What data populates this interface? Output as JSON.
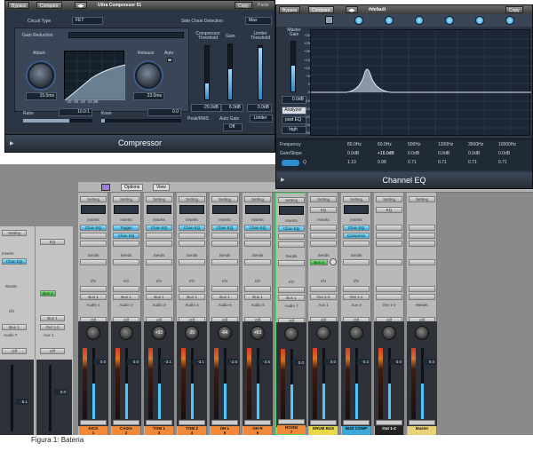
{
  "compressor": {
    "bypass": "Bypass",
    "compare": "Compare",
    "preset": "Ultra Compressor 01",
    "copy": "Copy",
    "paste": "Paste",
    "circuit_type_label": "Circuit Type",
    "circuit_type_value": "FET",
    "side_chain_label": "Side Chain Detection",
    "side_chain_value": "Max",
    "gain_reduction": "Gain Reduction",
    "attack_label": "Attack",
    "attack_value": "15.5ms",
    "release_label": "Release",
    "release_value": "23.0ms",
    "auto_label": "Auto",
    "graph_scale": "-40 -30 -20 -10 dB",
    "ratio_label": "Ratio",
    "ratio_value": "10.0:1",
    "knee_label": "Knee",
    "knee_value": "0.0",
    "threshold_label": "Compressor Threshold",
    "threshold_value": "-29.0dB",
    "gain_label": "Gain",
    "gain_value": "6.0dB",
    "limiter_label": "Limiter Threshold",
    "limiter_value": "0.0dB",
    "peak_rms": "Peak/RMS",
    "auto_gain_label": "Auto Gain",
    "auto_gain_value": "Off",
    "limiter_btn": "Limiter",
    "title": "Compressor"
  },
  "eq": {
    "bypass": "Bypass",
    "compare": "Compare",
    "preset": "#default",
    "copy": "Copy",
    "master_gain_label": "Master Gain",
    "master_value": "0.0dB",
    "analyzer": "Analyzer",
    "post_eq": "post EQ",
    "high": "high",
    "db_scale": [
      "+30",
      "+25",
      "+20",
      "+15",
      "+10",
      "+5",
      "0",
      "-5",
      "-10",
      "-15",
      "-20",
      "-25",
      "-30"
    ],
    "freq_scale": [
      "20",
      "50",
      "100",
      "200",
      "500",
      "1k",
      "2k",
      "5k",
      "10k",
      "20k"
    ],
    "frequency_label": "Frequency",
    "gain_slope_label": "Gain/Slope",
    "q_label": "Q",
    "freqs": [
      "80.0Hz",
      "60.0Hz",
      "500Hz",
      "1200Hz",
      "3500Hz",
      "10000Hz"
    ],
    "gains": [
      "0.0dB",
      "+16.0dB",
      "0.0dB",
      "0.0dB",
      "0.0dB",
      "0.0dB"
    ],
    "qs": [
      "1.10",
      "0.98",
      "0.71",
      "0.71",
      "0.71",
      "0.71"
    ],
    "title": "Channel EQ"
  },
  "mixer": {
    "options": "Options",
    "view": "View",
    "setting": "Setting",
    "inserts": "Inserts",
    "sends": "Sends",
    "io": "I/O",
    "off": "Off",
    "left_strips": [
      {
        "eq": "",
        "insert": "Chan EQ",
        "send": "",
        "out": "Bus 1",
        "route": "Audio 7",
        "gain": "-5.1"
      },
      {
        "eq": "EQ",
        "insert": "",
        "send": "Bus 2",
        "out": "Bus 1",
        "route": "Aux 1",
        "gain": "0.0",
        "out2": "Out 1-2"
      }
    ],
    "strips": [
      {
        "name": "KICK",
        "num": "1",
        "insert1": "Chan EQ",
        "insert2": "",
        "out": "Bus 1",
        "route": "Audio 1",
        "pan": "",
        "gain": "0.0",
        "color": "#f08a3a"
      },
      {
        "name": "CAIXA",
        "num": "2",
        "insert1": "Trigger",
        "insert2": "Chan EQ",
        "out": "Bus 1",
        "route": "Audio 2",
        "pan": "",
        "gain": "0.0",
        "color": "#f08a3a"
      },
      {
        "name": "TOM 1",
        "num": "3",
        "insert1": "Chan EQ",
        "insert2": "",
        "out": "Bus 1",
        "route": "Audio 3",
        "pan": "+10",
        "gain": "-3.1",
        "color": "#f08a3a"
      },
      {
        "name": "TOM 2",
        "num": "4",
        "insert1": "Chan EQ",
        "insert2": "",
        "out": "Bus 1",
        "route": "Audio 4",
        "pan": "-20",
        "gain": "-3.1",
        "color": "#f08a3a"
      },
      {
        "name": "OH L",
        "num": "5",
        "insert1": "Chan EQ",
        "insert2": "",
        "out": "Bus 1",
        "route": "Audio 5",
        "pan": "-64",
        "gain": "-2.5",
        "color": "#f08a3a"
      },
      {
        "name": "OH R",
        "num": "6",
        "insert1": "Chan EQ",
        "insert2": "",
        "out": "Bus 1",
        "route": "Audio 6",
        "pan": "+63",
        "gain": "-2.5",
        "color": "#f08a3a"
      },
      {
        "name": "ROOM",
        "num": "7",
        "insert1": "Chan EQ",
        "insert2": "",
        "out": "Bus 1",
        "route": "Audio 7",
        "pan": "",
        "gain": "0.0",
        "color": "#f08a3a"
      },
      {
        "name": "DRUM BUS",
        "num": "",
        "insert1": "",
        "insert2": "",
        "send": "Bus 2",
        "out": "Out 1-2",
        "route": "Aux 1",
        "pan": "",
        "gain": "0.0",
        "color": "#e8d84a",
        "eq": "EQ"
      },
      {
        "name": "BUS COMP",
        "num": "",
        "insert1": "Chan EQ",
        "insert2": "Compress",
        "out": "Out 1-2",
        "route": "Aux 2",
        "pan": "",
        "gain": "-0.2",
        "color": "#3ba8d8"
      },
      {
        "name": "Out 1-2",
        "num": "",
        "insert1": "",
        "insert2": "",
        "out": "",
        "route": "Out 1-2",
        "pan": "",
        "gain": "0.0",
        "color": "#222",
        "eq": "EQ"
      },
      {
        "name": "Master",
        "num": "",
        "insert1": "",
        "insert2": "",
        "out": "",
        "route": "Master",
        "pan": "",
        "gain": "0.0",
        "color": "#e8d27a"
      }
    ]
  },
  "caption": "Figura 1: Bateria",
  "colors": {
    "accent": "#4ec6ff",
    "panel": "#2b3544"
  }
}
